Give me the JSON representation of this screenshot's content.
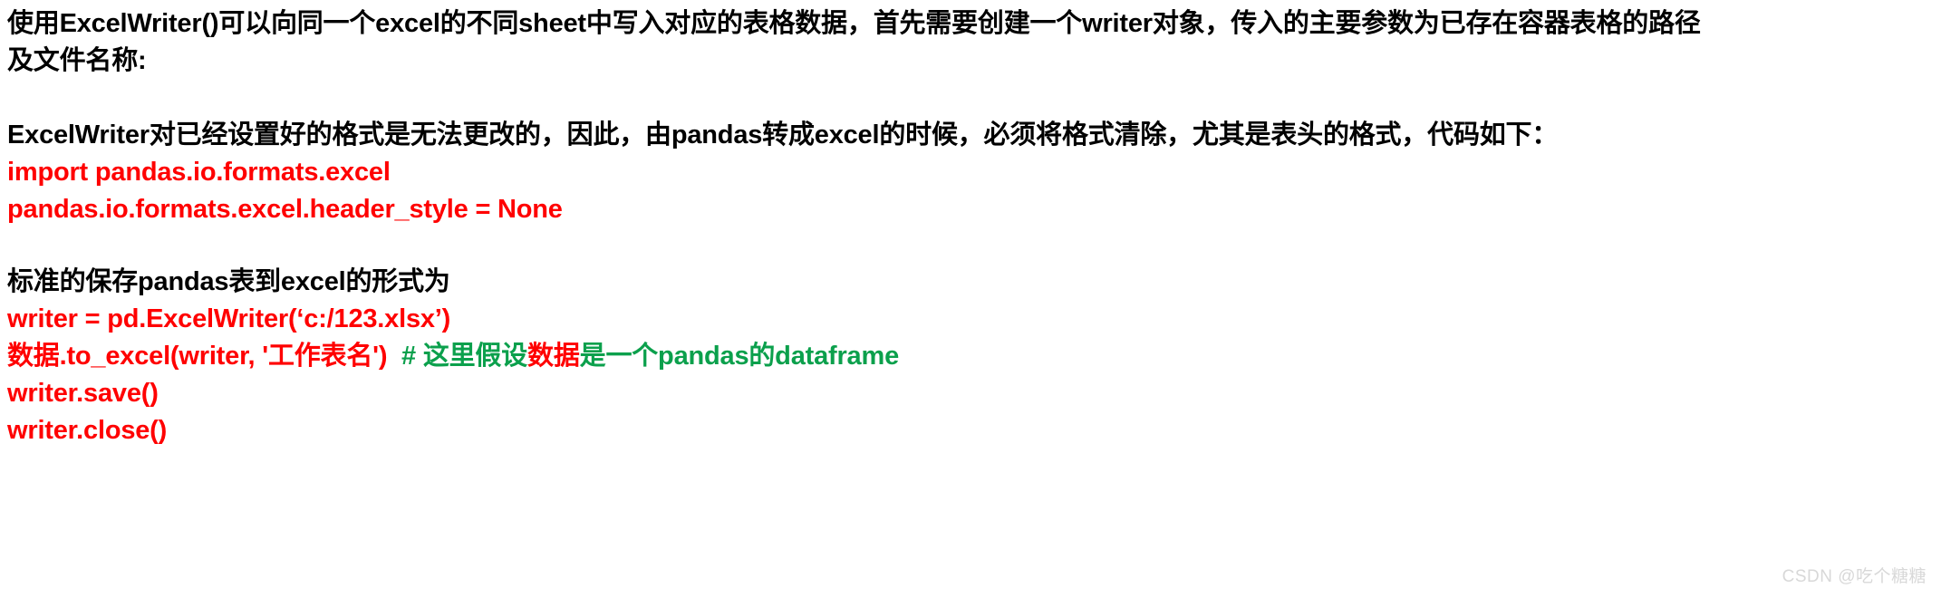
{
  "document": {
    "background_color": "#ffffff",
    "text_color": "#000000",
    "code_color": "#ff0000",
    "comment_color": "#0ba04c",
    "paragraph_1": {
      "line_1": "使用ExcelWriter()可以向同一个excel的不同sheet中写入对应的表格数据，首先需要创建一个writer对象，传入的主要参数为已存在容器表格的路径",
      "line_2": "及文件名称:"
    },
    "paragraph_2": {
      "line_1": "ExcelWriter对已经设置好的格式是无法更改的，因此，由pandas转成excel的时候，必须将格式清除，尤其是表头的格式，代码如下："
    },
    "code_block_1": {
      "line_1": "import pandas.io.formats.excel",
      "line_2": "pandas.io.formats.excel.header_style = None"
    },
    "paragraph_3": {
      "line_1": "标准的保存pandas表到excel的形式为"
    },
    "code_block_2": {
      "line_1": "writer = pd.ExcelWriter(‘c:/123.xlsx’)",
      "line_2_code": "数据.to_excel(writer, '工作表名')",
      "line_2_comment_a": "# 这里假设",
      "line_2_comment_b": "数据",
      "line_2_comment_c": "是一个pandas的dataframe",
      "line_3": "writer.save()",
      "line_4": "writer.close()"
    }
  },
  "watermark": {
    "text": "CSDN @吃个糖糖"
  }
}
